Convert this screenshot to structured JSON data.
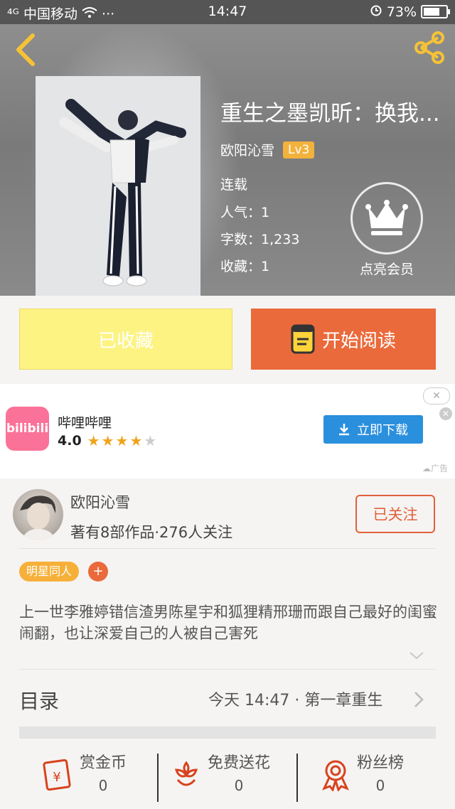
{
  "status_bar": {
    "signal": "⁴ᴳ",
    "carrier": "中国移动",
    "dots": "···",
    "time": "14:47",
    "battery": "73%",
    "battery_level": 0.73
  },
  "book": {
    "title": "重生之墨凯昕：换我...",
    "author": "欧阳沁雪",
    "level": "Lv3",
    "state": "连载",
    "popularity_label": "人气：",
    "popularity": "1",
    "words_label": "字数：",
    "words": "1,233",
    "favorites_label": "收藏：",
    "favorites": "1",
    "vip_label": "点亮会员"
  },
  "actions": {
    "favorited": "已收藏",
    "read": "开始阅读"
  },
  "ad": {
    "logo_text": "bilibili",
    "app_name": "哔哩哔哩",
    "rating": "4.0",
    "stars": 4,
    "download": "立即下载",
    "close": "✕",
    "mark": "广告"
  },
  "author_info": {
    "name": "欧阳沁雪",
    "stats": "著有8部作品·276人关注",
    "follow": "已关注"
  },
  "tag": "明星同人",
  "tag_add": "+",
  "description": "上一世李雅婷错信渣男陈星宇和狐狸精邢珊而跟自己最好的闺蜜闹翻，也让深爱自己的人被自己害死",
  "toc": {
    "label": "目录",
    "latest": "今天 14:47 · 第一章重生"
  },
  "bottom": [
    {
      "label": "赏金币",
      "count": "0"
    },
    {
      "label": "免费送花",
      "count": "0"
    },
    {
      "label": "粉丝榜",
      "count": "0"
    }
  ],
  "colors": {
    "accent": "#ea6a3b",
    "favorite_bg": "#fdf383",
    "tag": "#f6b03a",
    "ad_button": "#2a8fdd",
    "star": "#f0a31a"
  }
}
